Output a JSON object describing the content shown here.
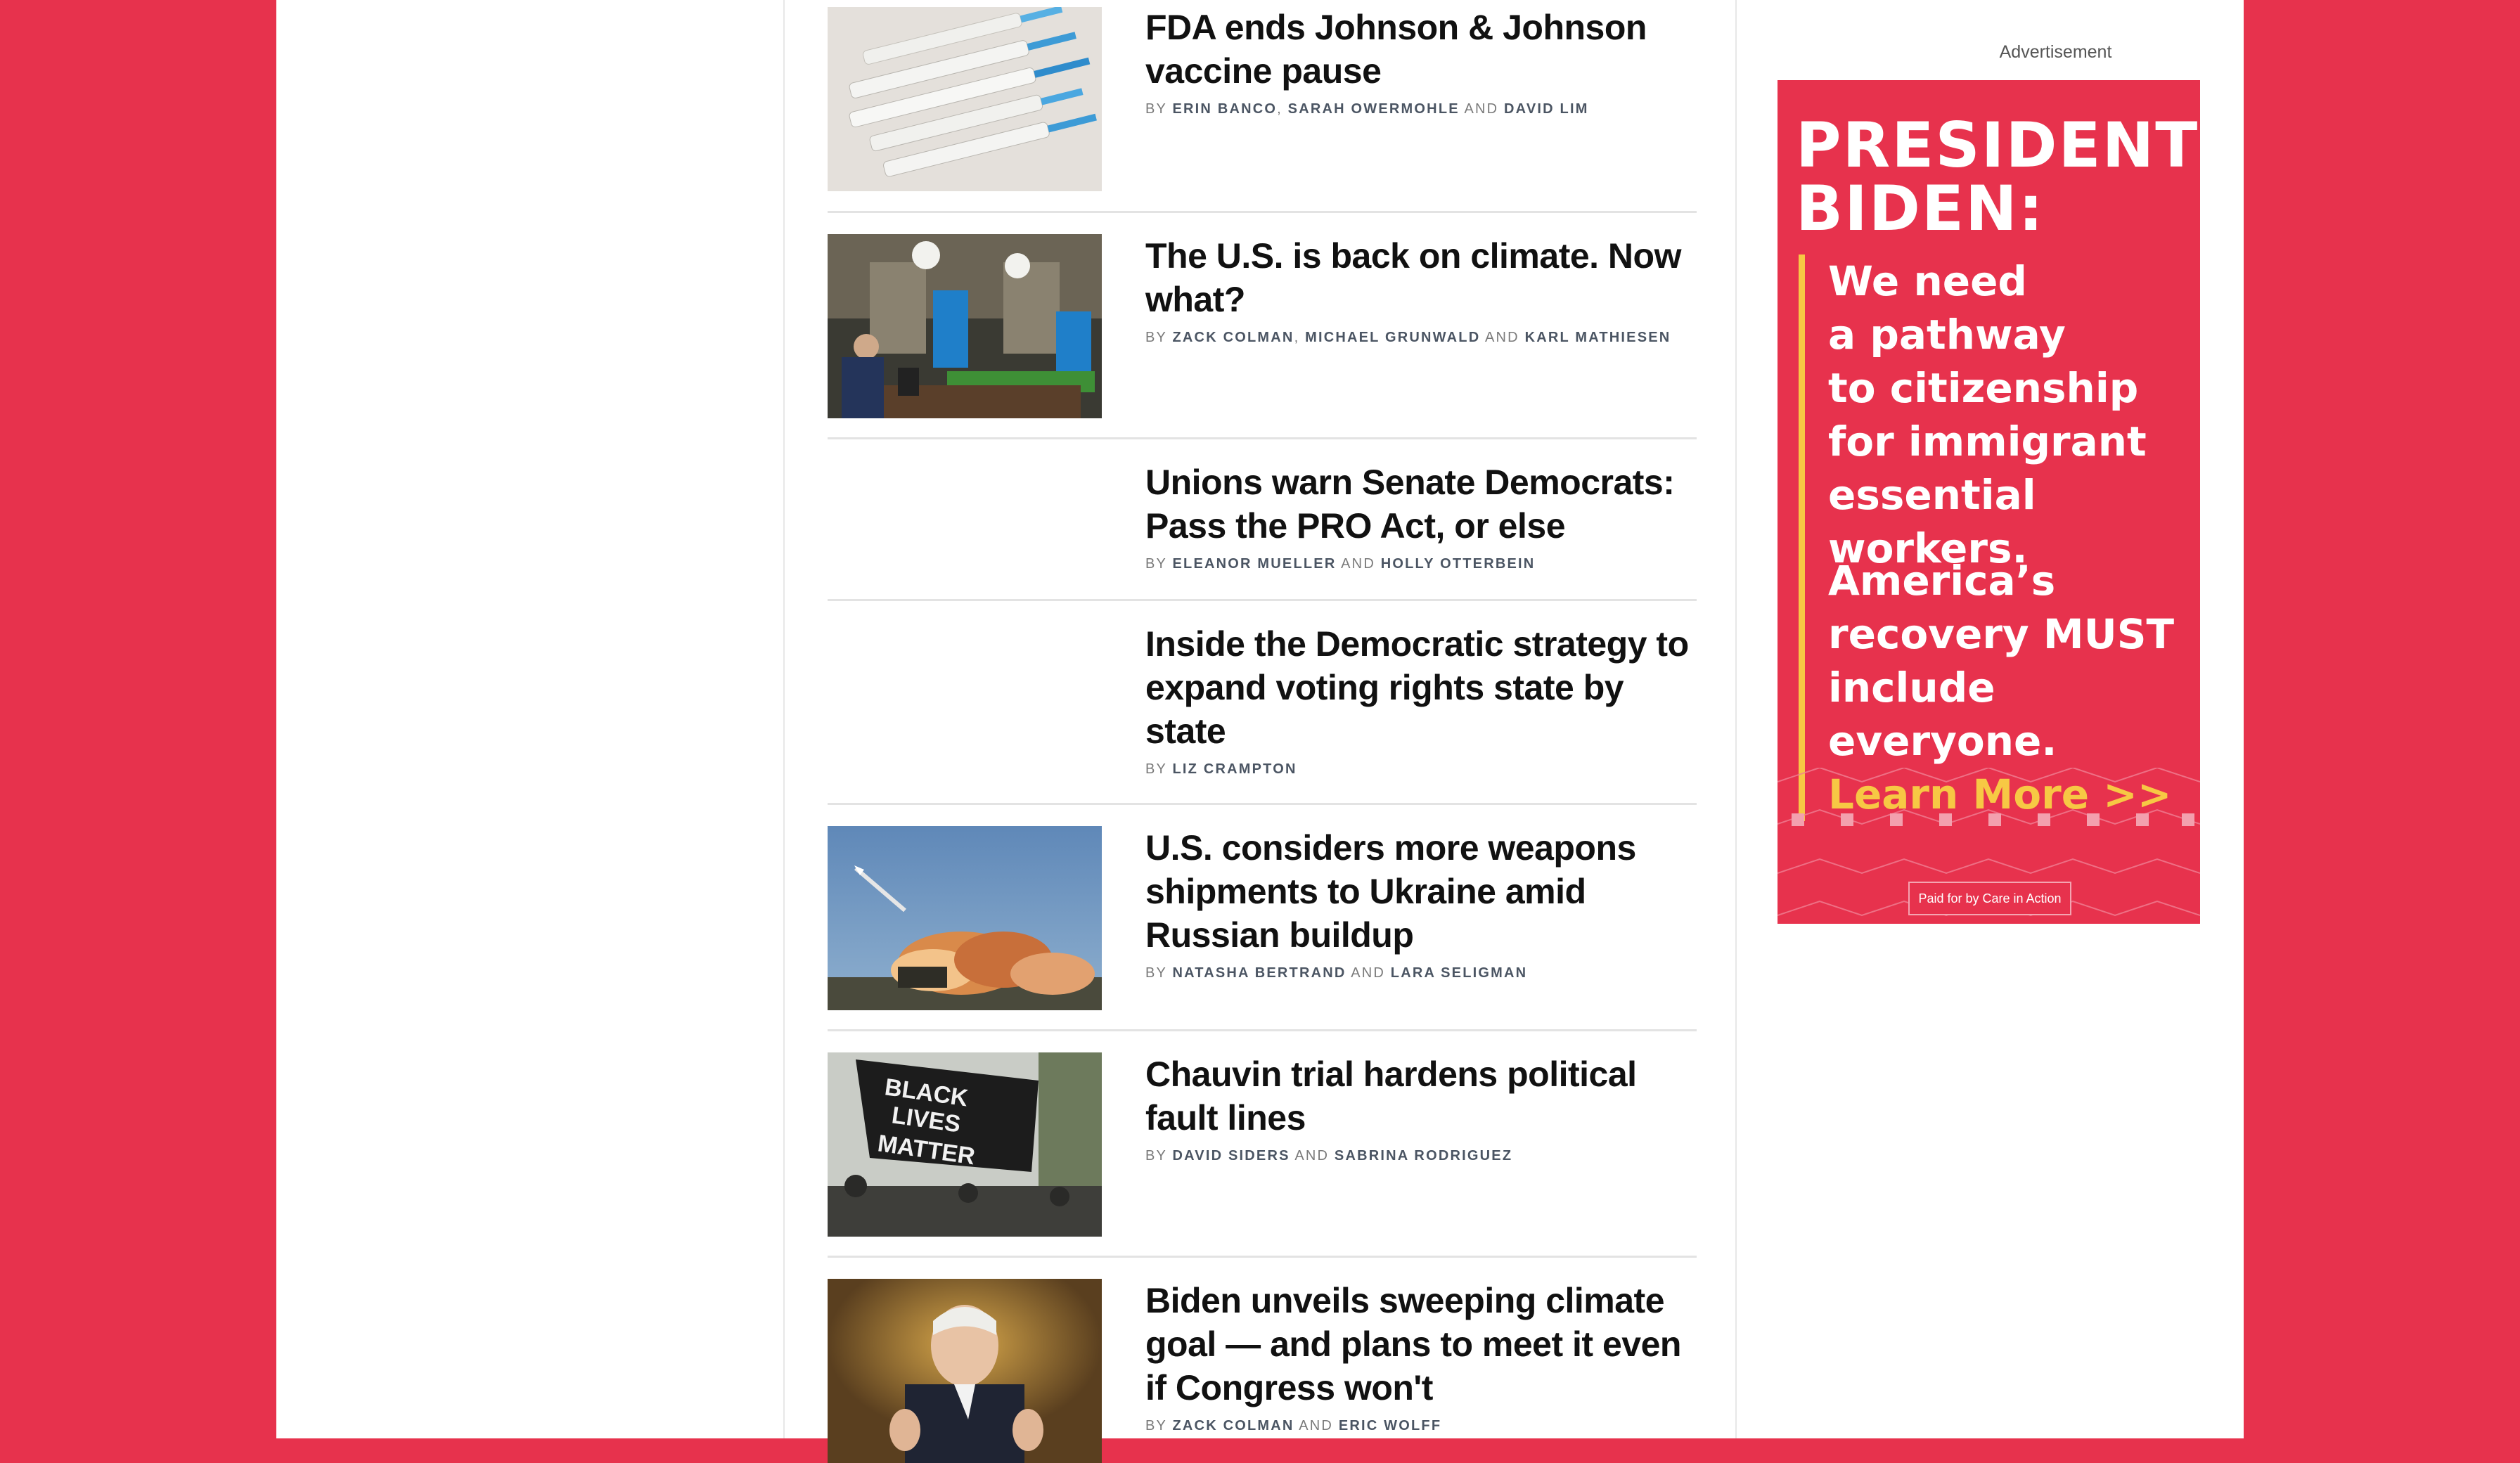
{
  "stories": [
    {
      "headline": "FDA ends Johnson & Johnson vaccine pause",
      "by": "BY",
      "authors": [
        "ERIN BANCO",
        "SARAH OWERMOHLE",
        "DAVID LIM"
      ],
      "image": "syringes-photo"
    },
    {
      "headline": "The U.S. is back on climate. Now what?",
      "by": "BY",
      "authors": [
        "ZACK COLMAN",
        "MICHAEL GRUNWALD",
        "KARL MATHIESEN"
      ],
      "image": "climate-summit-photo"
    },
    {
      "headline": "Unions warn Senate Democrats: Pass the PRO Act, or else",
      "by": "BY",
      "authors": [
        "ELEANOR MUELLER",
        "HOLLY OTTERBEIN"
      ],
      "image": null
    },
    {
      "headline": "Inside the Democratic strategy to expand voting rights state by state",
      "by": "BY",
      "authors": [
        "LIZ CRAMPTON"
      ],
      "image": null
    },
    {
      "headline": "U.S. considers more weapons shipments to Ukraine amid Russian buildup",
      "by": "BY",
      "authors": [
        "NATASHA BERTRAND",
        "LARA SELIGMAN"
      ],
      "image": "missile-launch-photo"
    },
    {
      "headline": "Chauvin trial hardens political fault lines",
      "by": "BY",
      "authors": [
        "DAVID SIDERS",
        "SABRINA RODRIGUEZ"
      ],
      "image": "black-lives-matter-flag-photo"
    },
    {
      "headline": "Biden unveils sweeping climate goal — and plans to meet it even if Congress won't",
      "by": "BY",
      "authors": [
        "ZACK COLMAN",
        "ERIC WOLFF"
      ],
      "image": "biden-speech-photo"
    }
  ],
  "byline_and": "AND",
  "sidebar": {
    "ad_label": "Advertisement"
  },
  "ad": {
    "title_line1": "PRESIDENT",
    "title_line2": "BIDEN:",
    "block1": [
      "We need",
      "a pathway",
      "to citizenship",
      "for immigrant",
      "essential workers."
    ],
    "block2": [
      "America’s",
      "recovery MUST",
      "include everyone."
    ],
    "learn_more": "Learn More >>",
    "paid_for": "Paid for by Care in Action"
  },
  "colors": {
    "brand_red": "#e7324d",
    "ad_yellow": "#f7c844"
  }
}
